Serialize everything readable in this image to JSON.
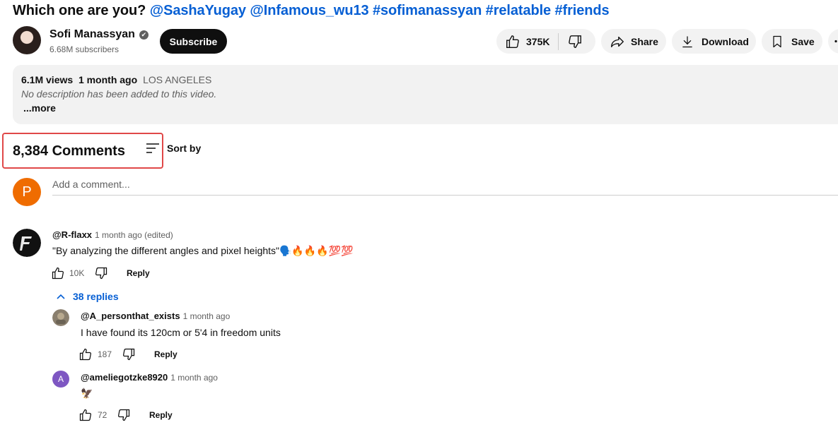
{
  "video": {
    "title_prefix": "Which one are you? ",
    "title_tags": "@SashaYugay @Infamous_wu13 #sofimanassyan #relatable #friends"
  },
  "channel": {
    "name": "Sofi Manassyan",
    "subscribers": "6.68M subscribers",
    "verified_icon": "✔"
  },
  "actions": {
    "subscribe": "Subscribe",
    "likes": "375K",
    "share": "Share",
    "download": "Download",
    "save": "Save"
  },
  "description": {
    "views": "6.1M views",
    "age": "1 month ago",
    "location": "LOS ANGELES",
    "text": "No description has been added to this video.",
    "more": "...more"
  },
  "comments": {
    "count_label": "8,384 Comments",
    "sort_label": "Sort by",
    "user_initial": "P",
    "add_placeholder": "Add a comment...",
    "top": {
      "author": "@R-flaxx",
      "time": "1 month ago (edited)",
      "text": "\"By analyzing the different angles and pixel heights\"🗣️🔥🔥🔥💯💯",
      "likes": "10K",
      "reply": "Reply",
      "replies_label": "38 replies"
    },
    "replies": [
      {
        "author": "@A_personthat_exists",
        "time": "1 month ago",
        "text": "I have found its 120cm or 5'4 in freedom units",
        "likes": "187",
        "reply": "Reply"
      },
      {
        "author": "@ameliegotzke8920",
        "time": "1 month ago",
        "text": "🦅",
        "likes": "72",
        "reply": "Reply",
        "initial": "A"
      }
    ]
  },
  "colors": {
    "link": "#065fd4",
    "highlight": "#e04848",
    "user_avatar": "#ef6c00",
    "reply_avatar": "#7e57c2"
  }
}
